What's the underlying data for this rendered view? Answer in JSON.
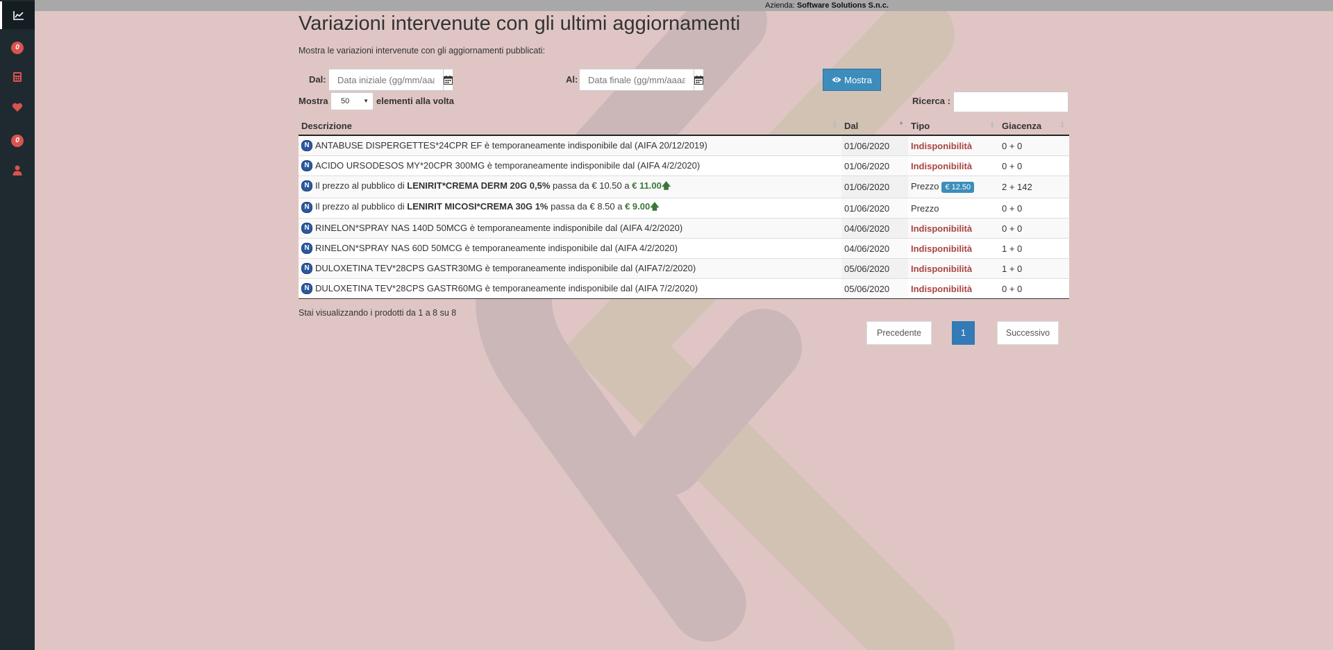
{
  "topbar": {
    "company_label": "Azienda:",
    "company_name": "Software Solutions S.n.c."
  },
  "sidebar": {
    "items": [
      {
        "icon": "chart-line-icon",
        "active": true
      },
      {
        "badge": "0"
      },
      {
        "icon": "calculator-icon"
      },
      {
        "icon": "heart-icon"
      },
      {
        "badge": "0"
      },
      {
        "icon": "user-icon"
      }
    ]
  },
  "page": {
    "title": "Variazioni intervenute con gli ultimi aggiornamenti",
    "subtitle": "Mostra le variazioni intervenute con gli aggiornamenti pubblicati:"
  },
  "filters": {
    "from_label": "Dal:",
    "from_placeholder": "Data iniziale (gg/mm/aaaa)",
    "to_label": "Al:",
    "to_placeholder": "Data finale (gg/mm/aaaa)",
    "show_button": "Mostra",
    "page_size_prefix": "Mostra",
    "page_size_value": "50",
    "page_size_suffix": "elementi alla volta",
    "search_label": "Ricerca :"
  },
  "table": {
    "columns": [
      "Descrizione",
      "Dal",
      "Tipo",
      "Giacenza"
    ],
    "rows": [
      {
        "badge": "N",
        "desc": "ANTABUSE DISPERGETTES*24CPR EF è temporaneamente indisponibile dal (AIFA 20/12/2019)",
        "date": "01/06/2020",
        "type": "Indisponibilità",
        "stock": "0 + 0"
      },
      {
        "badge": "N",
        "desc": "ACIDO URSODESOS MY*20CPR 300MG è temporaneamente indisponibile dal (AIFA 4/2/2020)",
        "date": "01/06/2020",
        "type": "Indisponibilità",
        "stock": "0 + 0"
      },
      {
        "badge": "N",
        "desc_prefix": "Il prezzo al pubblico di",
        "product": "LENIRIT*CREMA DERM 20G 0,5%",
        "desc_mid": "passa da € 10.50 a",
        "new_price": "€ 11.00",
        "date": "01/06/2020",
        "type": "Prezzo",
        "price_badge": "€ 12.50",
        "stock": "2 + 142"
      },
      {
        "badge": "N",
        "desc_prefix": "Il prezzo al pubblico di",
        "product": "LENIRIT MICOSI*CREMA 30G 1%",
        "desc_mid": "passa da € 8.50 a",
        "new_price": "€ 9.00",
        "date": "01/06/2020",
        "type": "Prezzo",
        "stock": "0 + 0"
      },
      {
        "badge": "N",
        "desc": "RINELON*SPRAY NAS 140D 50MCG è temporaneamente indisponibile dal (AIFA 4/2/2020)",
        "date": "04/06/2020",
        "type": "Indisponibilità",
        "stock": "0 + 0"
      },
      {
        "badge": "N",
        "desc": "RINELON*SPRAY NAS 60D 50MCG è temporaneamente indisponibile dal (AIFA 4/2/2020)",
        "date": "04/06/2020",
        "type": "Indisponibilità",
        "stock": "1 + 0"
      },
      {
        "badge": "N",
        "desc": "DULOXETINA TEV*28CPS GASTR30MG è temporaneamente indisponibile dal (AIFA7/2/2020)",
        "date": "05/06/2020",
        "type": "Indisponibilità",
        "stock": "1 + 0"
      },
      {
        "badge": "N",
        "desc": "DULOXETINA TEV*28CPS GASTR60MG è temporaneamente indisponibile dal (AIFA 7/2/2020)",
        "date": "05/06/2020",
        "type": "Indisponibilità",
        "stock": "0 + 0"
      }
    ]
  },
  "footer": {
    "info": "Stai visualizzando i prodotti da 1 a 8 su 8",
    "prev": "Precedente",
    "page": "1",
    "next": "Successivo"
  }
}
